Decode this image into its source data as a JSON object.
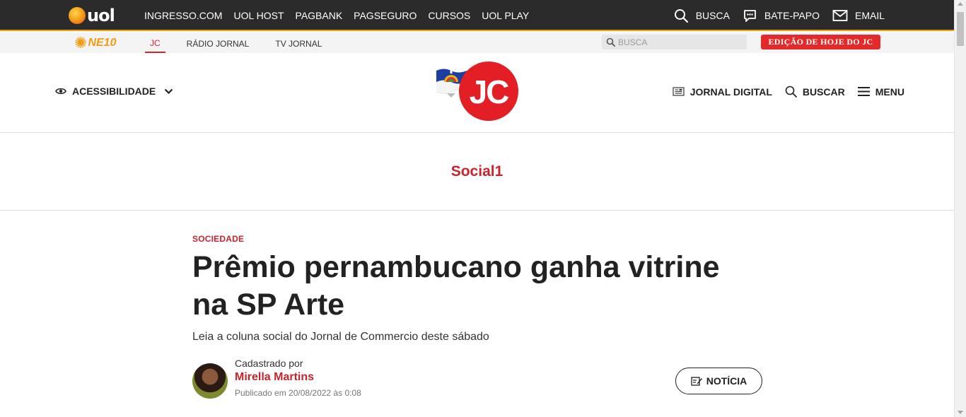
{
  "uol_bar": {
    "logo_text": "uol",
    "nav": [
      "INGRESSO.COM",
      "UOL HOST",
      "PAGBANK",
      "PAGSEGURO",
      "CURSOS",
      "UOL PLAY"
    ],
    "right": {
      "busca_label": "BUSCA",
      "batepapo_label": "BATE-PAPO",
      "email_label": "EMAIL"
    },
    "accent_color": "#f39c12"
  },
  "ne10_bar": {
    "logo_text": "NE10",
    "nav": [
      {
        "label": "JC",
        "active": true
      },
      {
        "label": "RÁDIO JORNAL",
        "active": false
      },
      {
        "label": "TV JORNAL",
        "active": false
      }
    ],
    "search_placeholder": "BUSCA",
    "edicao_label": "EDIÇÃO DE HOJE DO JC"
  },
  "header": {
    "acessibilidade_label": "ACESSIBILIDADE",
    "logo_text": "JC",
    "jornal_digital_label": "JORNAL DIGITAL",
    "buscar_label": "BUSCAR",
    "menu_label": "MENU",
    "brand_color": "#e31e25"
  },
  "section": {
    "title": "Social1"
  },
  "article": {
    "kicker": "SOCIEDADE",
    "headline": "Prêmio pernambucano ganha vitrine na SP Arte",
    "summary": "Leia a coluna social do Jornal de Commercio deste sábado",
    "author": {
      "by_label": "Cadastrado por",
      "name": "Mirella Martins",
      "published": "Publicado em 20/08/2022 às 0:08"
    },
    "type_label": "NOTÍCIA"
  },
  "icons": [
    "search-icon",
    "chat-icon",
    "mail-icon",
    "eye-icon",
    "chevron-down-icon",
    "newspaper-icon",
    "hamburger-icon",
    "edit-icon"
  ]
}
